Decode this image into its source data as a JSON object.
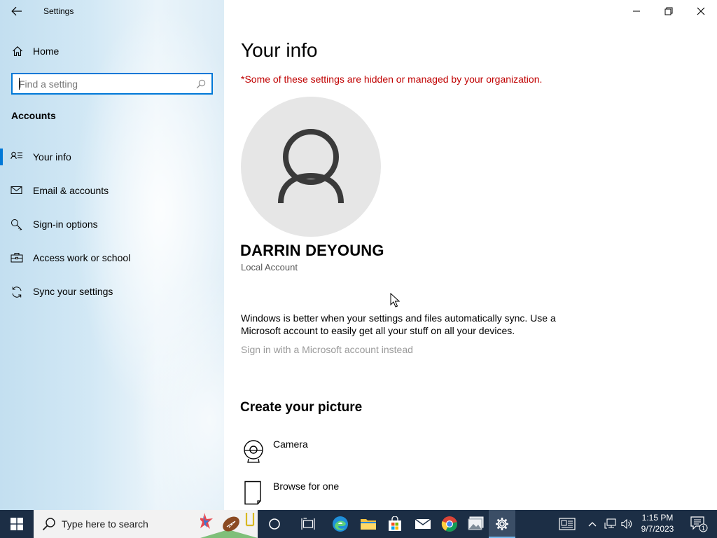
{
  "window": {
    "title": "Settings"
  },
  "sidebar": {
    "home_label": "Home",
    "search_placeholder": "Find a setting",
    "section_heading": "Accounts",
    "items": [
      {
        "label": "Your info",
        "icon": "person-list-icon",
        "selected": true
      },
      {
        "label": "Email & accounts",
        "icon": "mail-icon",
        "selected": false
      },
      {
        "label": "Sign-in options",
        "icon": "key-icon",
        "selected": false
      },
      {
        "label": "Access work or school",
        "icon": "briefcase-icon",
        "selected": false
      },
      {
        "label": "Sync your settings",
        "icon": "sync-icon",
        "selected": false
      }
    ]
  },
  "main": {
    "title": "Your info",
    "managed_note": "*Some of these settings are hidden or managed by your organization.",
    "user_name": "DARRIN DEYOUNG",
    "account_type": "Local Account",
    "sync_text": "Windows is better when your settings and files automatically sync. Use a Microsoft account to easily get all your stuff on all your devices.",
    "ms_account_link": "Sign in with a Microsoft account instead",
    "create_picture_heading": "Create your picture",
    "picture_options": [
      {
        "label": "Camera",
        "icon": "camera-icon"
      },
      {
        "label": "Browse for one",
        "icon": "document-icon"
      }
    ]
  },
  "taskbar": {
    "search_text": "Type here to search",
    "time": "1:15 PM",
    "date": "9/7/2023",
    "notification_count": "1"
  },
  "colors": {
    "accent": "#0078d7",
    "warning_text": "#c00000",
    "taskbar_bg": "#1c2e45"
  }
}
